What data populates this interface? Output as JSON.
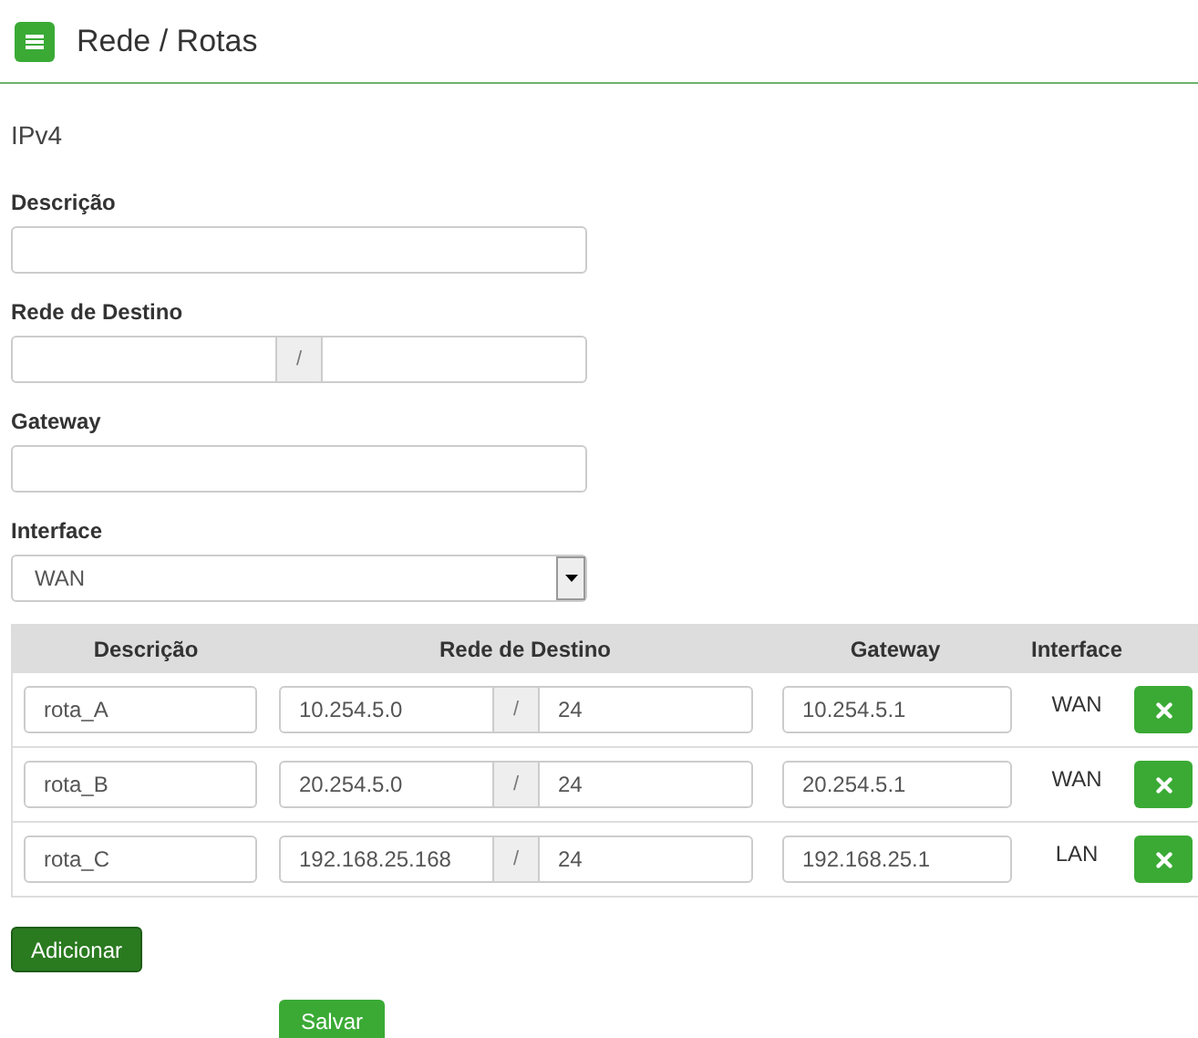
{
  "header": {
    "title": "Rede / Rotas"
  },
  "section": "IPv4",
  "form": {
    "description": {
      "label": "Descrição"
    },
    "destination": {
      "label": "Rede de Destino",
      "separator": "/"
    },
    "gateway": {
      "label": "Gateway"
    },
    "interface": {
      "label": "Interface",
      "value": "WAN"
    }
  },
  "table": {
    "columns": [
      "Descrição",
      "Rede de Destino",
      "Gateway",
      "Interface"
    ],
    "rows": [
      {
        "description": "rota_A",
        "network": "10.254.5.0",
        "separator": "/",
        "mask": "24",
        "gateway": "10.254.5.1",
        "interface": "WAN"
      },
      {
        "description": "rota_B",
        "network": "20.254.5.0",
        "separator": "/",
        "mask": "24",
        "gateway": "20.254.5.1",
        "interface": "WAN"
      },
      {
        "description": "rota_C",
        "network": "192.168.25.168",
        "separator": "/",
        "mask": "24",
        "gateway": "192.168.25.1",
        "interface": "LAN"
      }
    ]
  },
  "buttons": {
    "add": "Adicionar",
    "save": "Salvar"
  }
}
